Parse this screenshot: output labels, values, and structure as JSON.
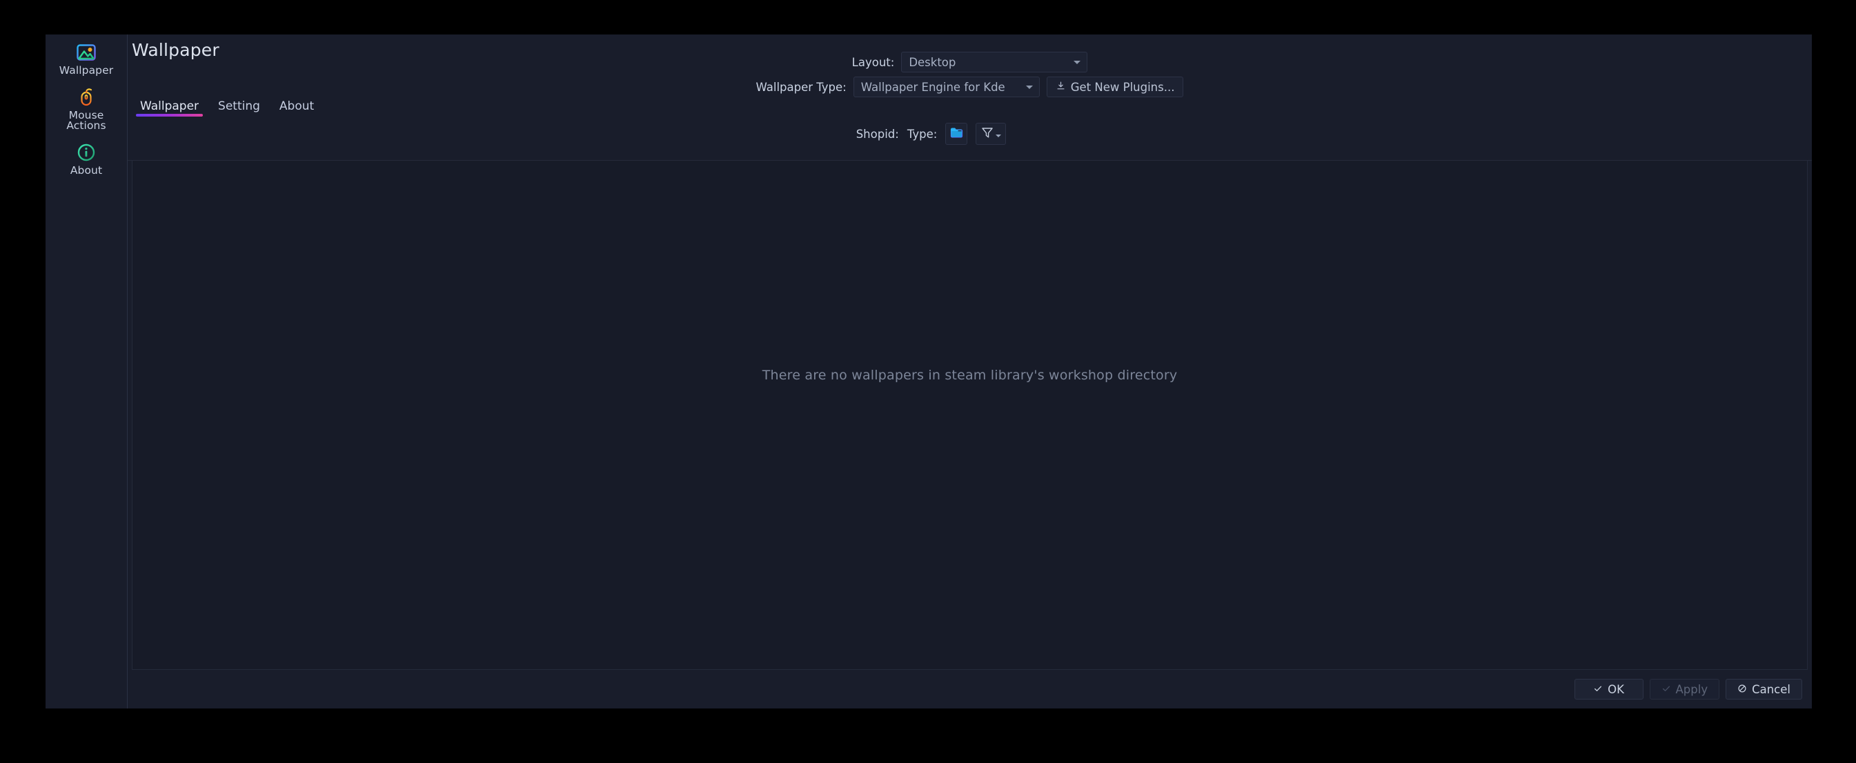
{
  "window": {
    "title": "Wallpaper",
    "bg": "#191d2b"
  },
  "sidebar": {
    "items": [
      {
        "label": "Wallpaper",
        "icon": "picture-icon",
        "selected": true
      },
      {
        "label": "Mouse\nActions",
        "icon": "mouse-icon",
        "selected": false
      },
      {
        "label": "About",
        "icon": "info-icon",
        "selected": false
      }
    ]
  },
  "header": {
    "page_title": "Wallpaper",
    "layout_label": "Layout:",
    "layout_value": "Desktop",
    "wallpaper_type_label": "Wallpaper Type:",
    "wallpaper_type_value": "Wallpaper Engine for Kde",
    "get_new_plugins_label": "Get New Plugins...",
    "get_new_plugins_icon": "download-icon"
  },
  "tabs": [
    {
      "label": "Wallpaper",
      "active": true
    },
    {
      "label": "Setting",
      "active": false
    },
    {
      "label": "About",
      "active": false
    }
  ],
  "toolbar": {
    "shopid_label": "Shopid:",
    "type_label": "Type:",
    "folder_icon": "folder-icon",
    "filter_icon": "filter-funnel-icon"
  },
  "content": {
    "empty_message": "There are no wallpapers in steam library's workshop directory"
  },
  "footer": {
    "ok_label": "OK",
    "ok_icon": "check-icon",
    "apply_label": "Apply",
    "apply_icon": "check-icon",
    "apply_disabled": true,
    "cancel_label": "Cancel",
    "cancel_icon": "cancel-circle-icon"
  },
  "colors": {
    "accent_start": "#6a3df0",
    "accent_end": "#e0409f",
    "window_bg": "#191d2b",
    "panel_bg": "#171b28",
    "text_primary": "#dde3ee",
    "text_muted": "#7d8699",
    "folder_blue": "#25a6f0",
    "icon_green": "#34d399",
    "icon_orange": "#f59e0b"
  }
}
